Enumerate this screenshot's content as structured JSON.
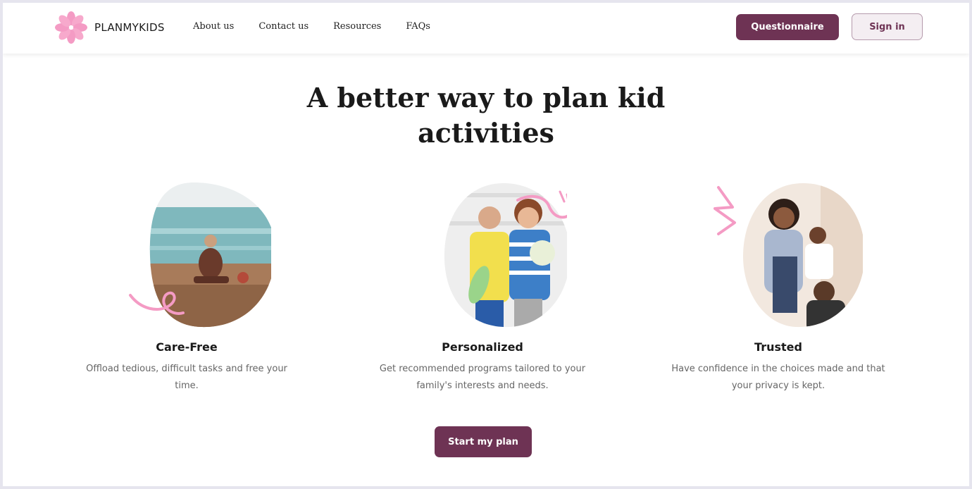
{
  "brand": {
    "name": "PLANMYKIDS",
    "accent": "#6e3354",
    "flower_color": "#f49bc4"
  },
  "nav": {
    "links": [
      "About us",
      "Contact us",
      "Resources",
      "FAQs"
    ],
    "questionnaire_label": "Questionnaire",
    "signin_label": "Sign in"
  },
  "hero": {
    "headline_line1": "A better way to plan kid",
    "headline_line2": "activities"
  },
  "features": [
    {
      "title": "Care-Free",
      "description": "Offload tedious, difficult tasks and free your time.",
      "image": "woman-meditating-on-beach-photo"
    },
    {
      "title": "Personalized",
      "description": "Get recommended programs tailored to your family's interests and needs.",
      "image": "two-kids-with-toys-photo"
    },
    {
      "title": "Trusted",
      "description": "Have confidence in the choices made and that your privacy is kept.",
      "image": "happy-family-playing-photo"
    }
  ],
  "cta": {
    "label": "Start my plan"
  }
}
